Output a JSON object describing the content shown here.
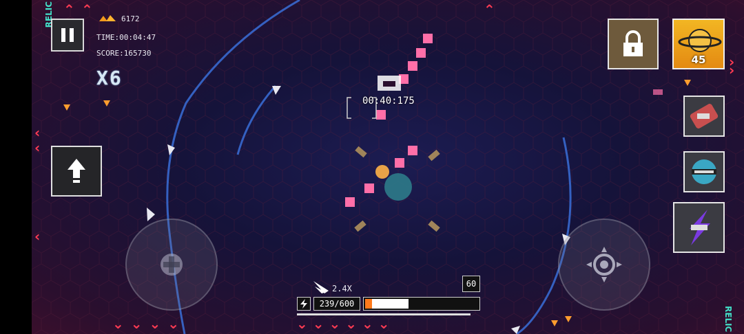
{
  "hud": {
    "gems": "6172",
    "time": "TIME:00:04:47",
    "score": "SCORE:165730",
    "multiplier": "X6"
  },
  "boss": {
    "timer": "00:40:175"
  },
  "relic": {
    "count": "45",
    "side_label": "RELIC"
  },
  "bottom": {
    "speed": "2.4X",
    "ammo": "239/600",
    "counter": "60",
    "energy_fraction": 0.38
  },
  "icons": {
    "pause": "pause-icon",
    "up": "arrow-up-icon",
    "lock": "lock-icon",
    "gem": "gem-icon",
    "energy": "lightning-icon",
    "camera": "camera-icon",
    "crosshair": "crosshair-icon",
    "dpad": "dpad-icon"
  },
  "colors": {
    "accent_red": "#ff3b53",
    "relic_gold": "#f2b623",
    "energy_orange": "#ff7a1c",
    "ring_blue": "#3a6fd8",
    "projectile_pink": "#ff6fa8"
  }
}
